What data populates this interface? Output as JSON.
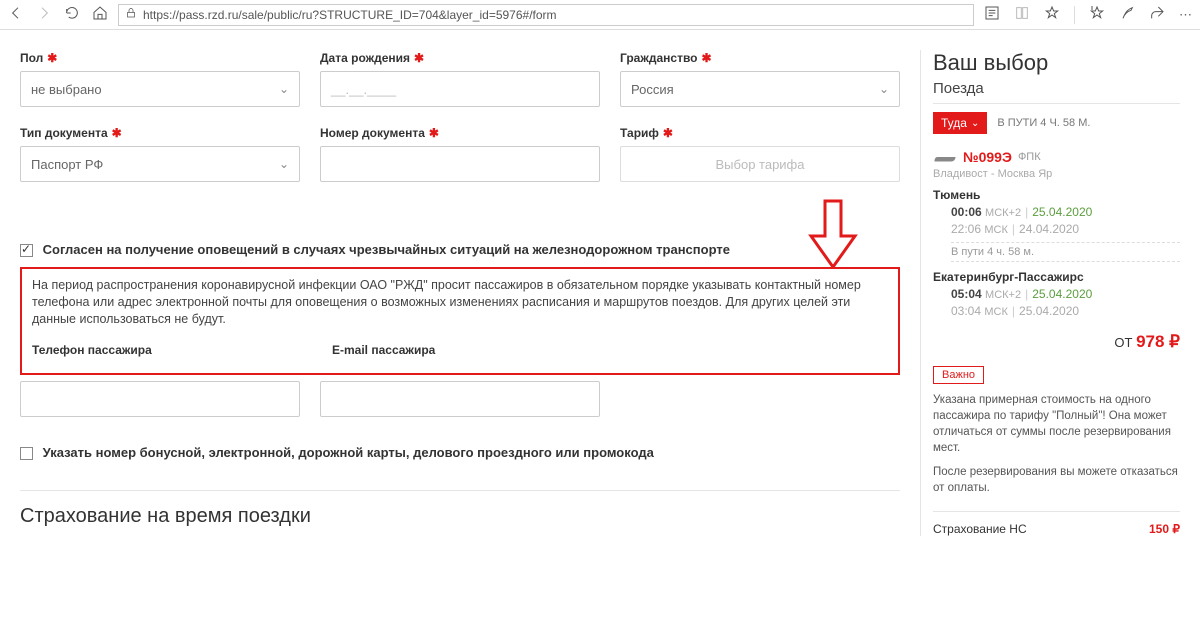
{
  "browser": {
    "url": "https://pass.rzd.ru/sale/public/ru?STRUCTURE_ID=704&layer_id=5976#/form"
  },
  "form": {
    "gender": {
      "label": "Пол",
      "value": "не выбрано"
    },
    "birthdate": {
      "label": "Дата рождения",
      "placeholder": "__.__.____"
    },
    "citizenship": {
      "label": "Гражданство",
      "value": "Россия"
    },
    "doc_type": {
      "label": "Тип документа",
      "value": "Паспорт РФ"
    },
    "doc_number": {
      "label": "Номер документа"
    },
    "tariff": {
      "label": "Тариф",
      "button": "Выбор тарифа"
    },
    "consent": "Согласен на получение оповещений в случаях чрезвычайных ситуаций на железнодорожном транспорте",
    "notice": "На период распространения коронавирусной инфекции ОАО \"РЖД\" просит пассажиров в обязательном порядке указывать контактный номер телефона или адрес электронной почты для оповещения о возможных изменениях расписания и маршрутов поездов. Для других целей эти данные использоваться не будут.",
    "phone_label": "Телефон пассажира",
    "email_label": "E-mail пассажира",
    "bonus": "Указать номер бонусной, электронной, дорожной карты, делового проездного или промокода",
    "insurance_section": "Страхование на время поездки"
  },
  "side": {
    "title": "Ваш выбор",
    "subtitle": "Поезда",
    "direction": "Туда",
    "travel_time": "В ПУТИ 4 Ч. 58 М.",
    "train_number": "№099Э",
    "operator": "ФПК",
    "route": "Владивост - Москва Яр",
    "from_city": "Тюмень",
    "from_time": "00:06",
    "from_tz": "МСК+2",
    "from_date": "25.04.2020",
    "from_time2": "22:06",
    "from_tz2": "МСК",
    "from_date2": "24.04.2020",
    "duration": "В пути  4 ч. 58 м.",
    "to_city": "Екатеринбург-Пассажирс",
    "to_time": "05:04",
    "to_tz": "МСК+2",
    "to_date": "25.04.2020",
    "to_time2": "03:04",
    "to_tz2": "МСК",
    "to_date2": "25.04.2020",
    "price_prefix": "ОТ",
    "price": "978 ₽",
    "important_label": "Важно",
    "important_text1": "Указана примерная стоимость на одного пассажира по тарифу \"Полный\"! Она может отличаться от суммы после резервирования мест.",
    "important_text2": "После резервирования вы можете отказаться от оплаты.",
    "insurance_label": "Страхование НС",
    "insurance_price": "150 ₽"
  }
}
